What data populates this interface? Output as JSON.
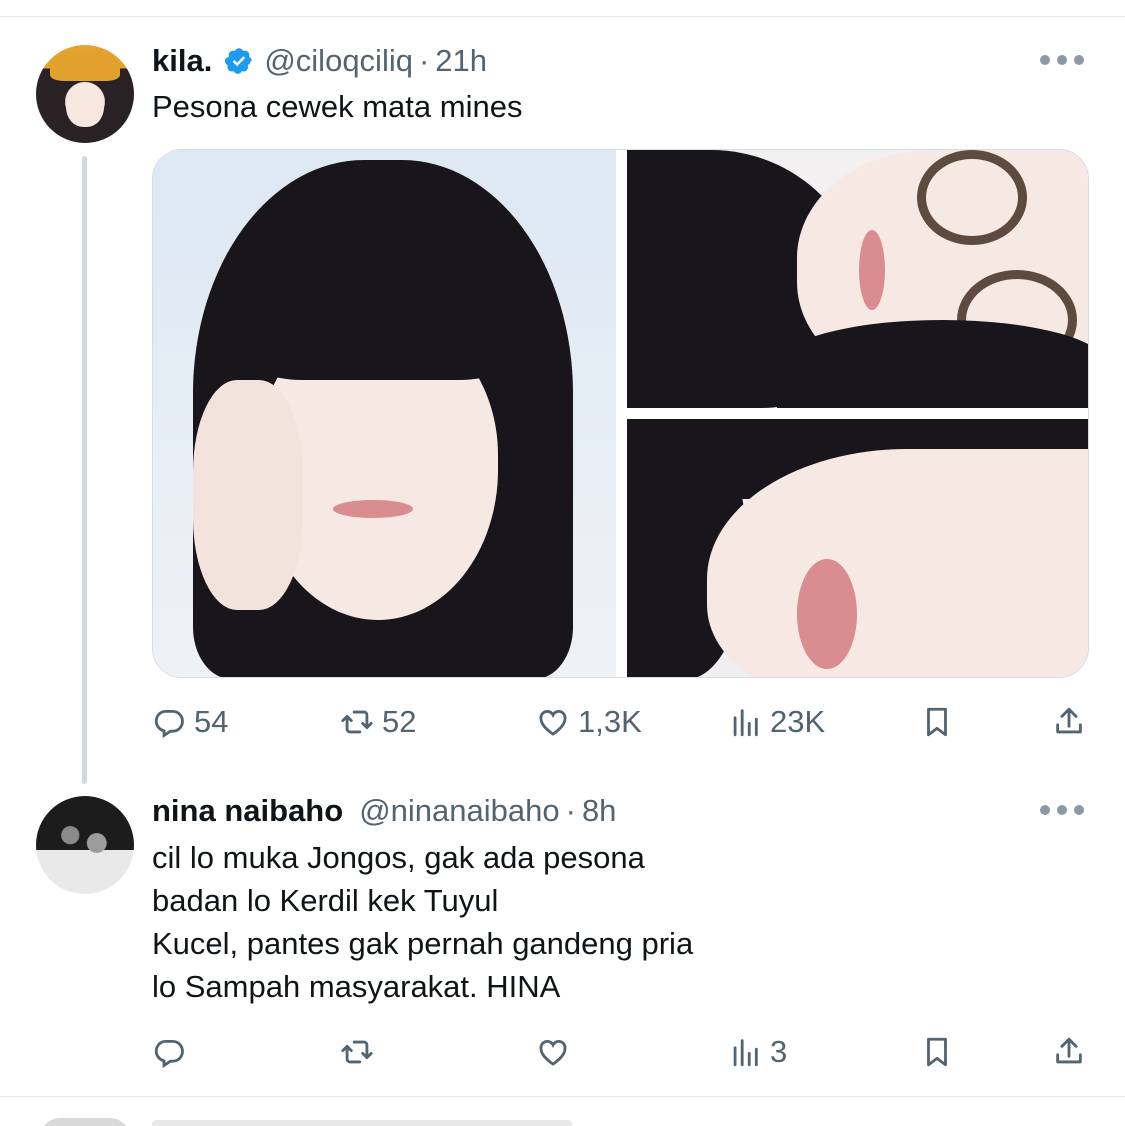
{
  "tweet": {
    "display_name": "kila.",
    "handle": "@ciloqciliq",
    "separator": "·",
    "time": "21h",
    "text": "Pesona cewek mata mines",
    "verified": true,
    "actions": {
      "replies": "54",
      "retweets": "52",
      "likes": "1,3K",
      "views": "23K"
    }
  },
  "reply": {
    "display_name": "nina naibaho",
    "handle": "@ninanaibaho",
    "separator": "·",
    "time": "8h",
    "lines": [
      "cil lo muka Jongos, gak ada pesona",
      "badan lo Kerdil kek Tuyul",
      "Kucel, pantes gak pernah gandeng pria",
      "lo Sampah masyarakat. HINA"
    ],
    "actions": {
      "replies": "",
      "retweets": "",
      "likes": "",
      "views": "3"
    }
  },
  "colors": {
    "text_primary": "#0f1419",
    "text_secondary": "#536471",
    "verified_blue": "#1d9bf0",
    "divider": "#e6e9ec",
    "thread_line": "#cfd9de"
  },
  "icons": [
    "verified-badge-icon",
    "more-icon",
    "reply-icon",
    "retweet-icon",
    "like-icon",
    "views-icon",
    "bookmark-icon",
    "share-icon"
  ]
}
